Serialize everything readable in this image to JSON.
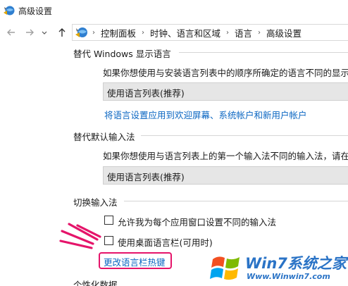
{
  "window": {
    "title": "高级设置",
    "app_icon": "language-settings-icon"
  },
  "nav": {
    "back_icon": "back-arrow-icon",
    "forward_icon": "forward-arrow-icon",
    "recent_icon": "chevron-down-icon",
    "up_icon": "up-arrow-icon",
    "breadcrumbs": [
      "控制面板",
      "时钟、语言和区域",
      "语言",
      "高级设置"
    ],
    "separator": "›"
  },
  "sections": {
    "display_language": {
      "title": "替代 Windows 显示语言",
      "description": "如果你想使用与安装语言列表中的顺序所确定的语言不同的显示语",
      "select_value": "使用语言列表(推荐)",
      "link": "将语言设置应用到欢迎屏幕、系统帐户和新用户帐户"
    },
    "input_method": {
      "title": "替代默认输入法",
      "description": "如果你想使用与语言列表上的第一个输入法不同的输入法，请在此",
      "select_value": "使用语言列表(推荐)"
    },
    "switch_input": {
      "title": "切换输入法",
      "checkbox_per_app": {
        "label": "允许我为每个应用窗口设置不同的输入法",
        "checked": false
      },
      "checkbox_langbar": {
        "label": "使用桌面语言栏(可用时)",
        "checked": false
      },
      "link": "更改语言栏热键"
    },
    "personalization": {
      "title": "个性化数据"
    }
  },
  "annotation": {
    "highlight_color": "#e5146a"
  },
  "watermark": {
    "title": "Win7系统之家",
    "url": "Www.Winwin7.com",
    "logo": "windows-logo-icon"
  }
}
